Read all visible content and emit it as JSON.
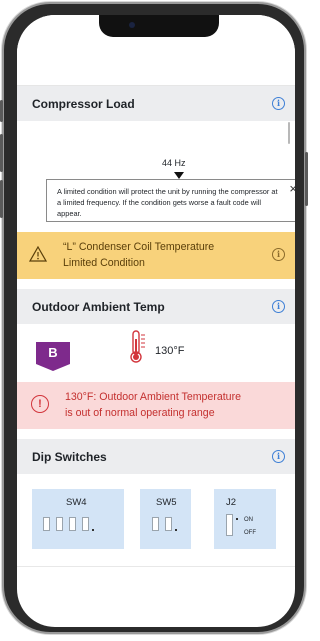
{
  "sections": {
    "compressor": {
      "title": "Compressor Load",
      "hz_label": "44 Hz",
      "tooltip": "A limited condition will protect the unit by running the compressor at a limited frequency. If the condition gets worse a fault code will appear.",
      "warning_line1": "“L” Condenser Coil Temperature",
      "warning_line2": "Limited Condition"
    },
    "ambient": {
      "title": "Outdoor Ambient Temp",
      "badge": "B",
      "temperature": "130°F",
      "error_line1": "130°F: Outdoor Ambient Temperature",
      "error_line2": "is out of normal operating range"
    },
    "dip": {
      "title": "Dip Switches",
      "sw4_label": "SW4",
      "sw5_label": "SW5",
      "j2_label": "J2",
      "j2_on": "ON",
      "j2_off": "OFF"
    }
  },
  "icons": {
    "info": "i",
    "close": "×",
    "error": "!"
  },
  "colors": {
    "warning_bg": "#f8d27b",
    "error_bg": "#fad9d9",
    "error_text": "#c4302f",
    "info_blue": "#3d7fd6",
    "badge_purple": "#7e2a8c",
    "dip_bg": "#d3e4f6"
  }
}
